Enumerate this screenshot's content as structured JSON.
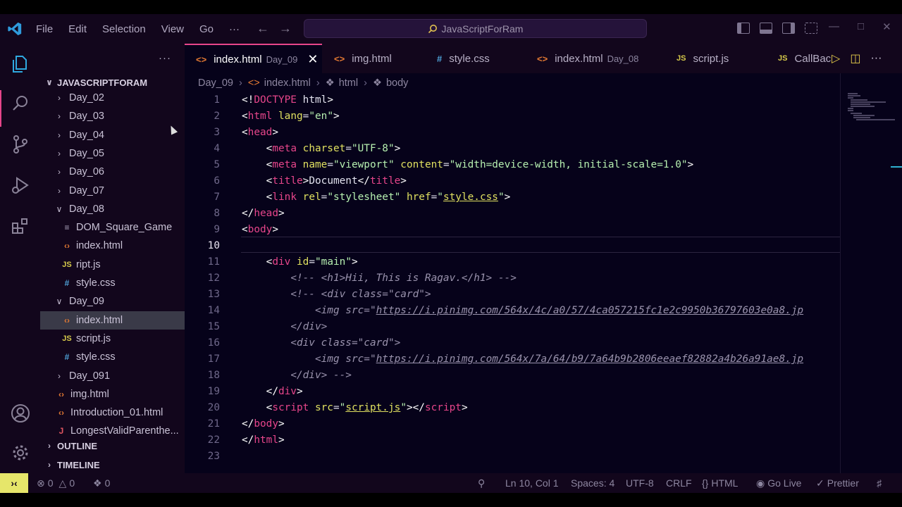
{
  "menu": [
    "File",
    "Edit",
    "Selection",
    "View",
    "Go",
    "···"
  ],
  "search": {
    "text": "JavaScriptForRam"
  },
  "explorer": {
    "root": "JAVASCRIPTFORAM",
    "rows": [
      {
        "label": "Day_02",
        "kind": "folder",
        "open": false
      },
      {
        "label": "Day_03",
        "kind": "folder",
        "open": false
      },
      {
        "label": "Day_04",
        "kind": "folder",
        "open": false
      },
      {
        "label": "Day_05",
        "kind": "folder",
        "open": false
      },
      {
        "label": "Day_06",
        "kind": "folder",
        "open": false
      },
      {
        "label": "Day_07",
        "kind": "folder",
        "open": false
      },
      {
        "label": "Day_08",
        "kind": "folder",
        "open": true
      },
      {
        "label": "DOM_Square_Game",
        "kind": "txt"
      },
      {
        "label": "index.html",
        "kind": "html"
      },
      {
        "label": "ript.js",
        "kind": "js"
      },
      {
        "label": "style.css",
        "kind": "css"
      },
      {
        "label": "Day_09",
        "kind": "folder",
        "open": true
      },
      {
        "label": "index.html",
        "kind": "html"
      },
      {
        "label": "script.js",
        "kind": "js"
      },
      {
        "label": "style.css",
        "kind": "css"
      },
      {
        "label": "Day_091",
        "kind": "folder",
        "open": false
      },
      {
        "label": "img.html",
        "kind": "html"
      },
      {
        "label": "Introduction_01.html",
        "kind": "html"
      },
      {
        "label": "LongestValidParenthe...",
        "kind": "j"
      }
    ],
    "outline": "OUTLINE",
    "timeline": "TIMELINE"
  },
  "tabs": [
    {
      "label": "index.html",
      "desc": "Day_09",
      "icon": "<>",
      "kind": "html"
    },
    {
      "label": "img.html",
      "desc": "",
      "icon": "<>",
      "kind": "html"
    },
    {
      "label": "style.css",
      "desc": "",
      "icon": "#",
      "kind": "css"
    },
    {
      "label": "index.html",
      "desc": "Day_08",
      "icon": "<>",
      "kind": "html"
    },
    {
      "label": "script.js",
      "desc": "",
      "icon": "JS",
      "kind": "js"
    },
    {
      "label": "CallBac",
      "desc": "",
      "icon": "JS",
      "kind": "js"
    }
  ],
  "breadcrumb": [
    "Day_09",
    "index.html",
    "html",
    "body"
  ],
  "code_lines": [
    "1",
    "2",
    "3",
    "4",
    "5",
    "6",
    "7",
    "8",
    "9",
    "10",
    "11",
    "12",
    "13",
    "14",
    "15",
    "16",
    "17",
    "18",
    "19",
    "20",
    "21",
    "22",
    "23"
  ],
  "code": {
    "l1_doctype": "DOCTYPE",
    "l1_html": "html",
    "l2_lang": "lang",
    "l2_val": "\"en\"",
    "l4_charset": "charset",
    "l4_val": "\"UTF-8\"",
    "l5_name": "name",
    "l5_nameval": "\"viewport\"",
    "l5_content": "content",
    "l5_contentval": "\"width=device-width, initial-scale=1.0\"",
    "l6_text": "Document",
    "l7_rel": "rel",
    "l7_relval": "\"stylesheet\"",
    "l7_href": "href",
    "l7_hrefval": "style.css",
    "l11_id": "id",
    "l11_idval": "\"main\"",
    "l12": "<!-- <h1>Hii, This is Ragav.</h1> -->",
    "l13_a": "<!-- <div ",
    "l13_cls": "class",
    "l13_b": "=\"card\">",
    "l14_a": "<img ",
    "l14_src": "src",
    "l14_url": "https://i.pinimg.com/564x/4c/a0/57/4ca057215fc1e2c9950b36797603e0a8.jp",
    "l15": "</div>",
    "l16_a": "<div ",
    "l16_cls": "class",
    "l16_b": "=\"card\">",
    "l17_url": "https://i.pinimg.com/564x/7a/64/b9/7a64b9b2806eeaef82882a4b26a91ae8.jp",
    "l18": "</div> -->",
    "l20_src": "src",
    "l20_val": "script.js"
  },
  "status": {
    "errors": "0",
    "warnings": "0",
    "ports": "0",
    "position": "Ln 10, Col 1",
    "spaces": "Spaces: 4",
    "encoding": "UTF-8",
    "eol": "CRLF",
    "language": "HTML",
    "golive": "Go Live",
    "prettier": "Prettier"
  },
  "colors": {
    "accent": "#e6458a",
    "remote": "#e6e66a",
    "bg": "#06021a",
    "chrome": "#12061c"
  }
}
